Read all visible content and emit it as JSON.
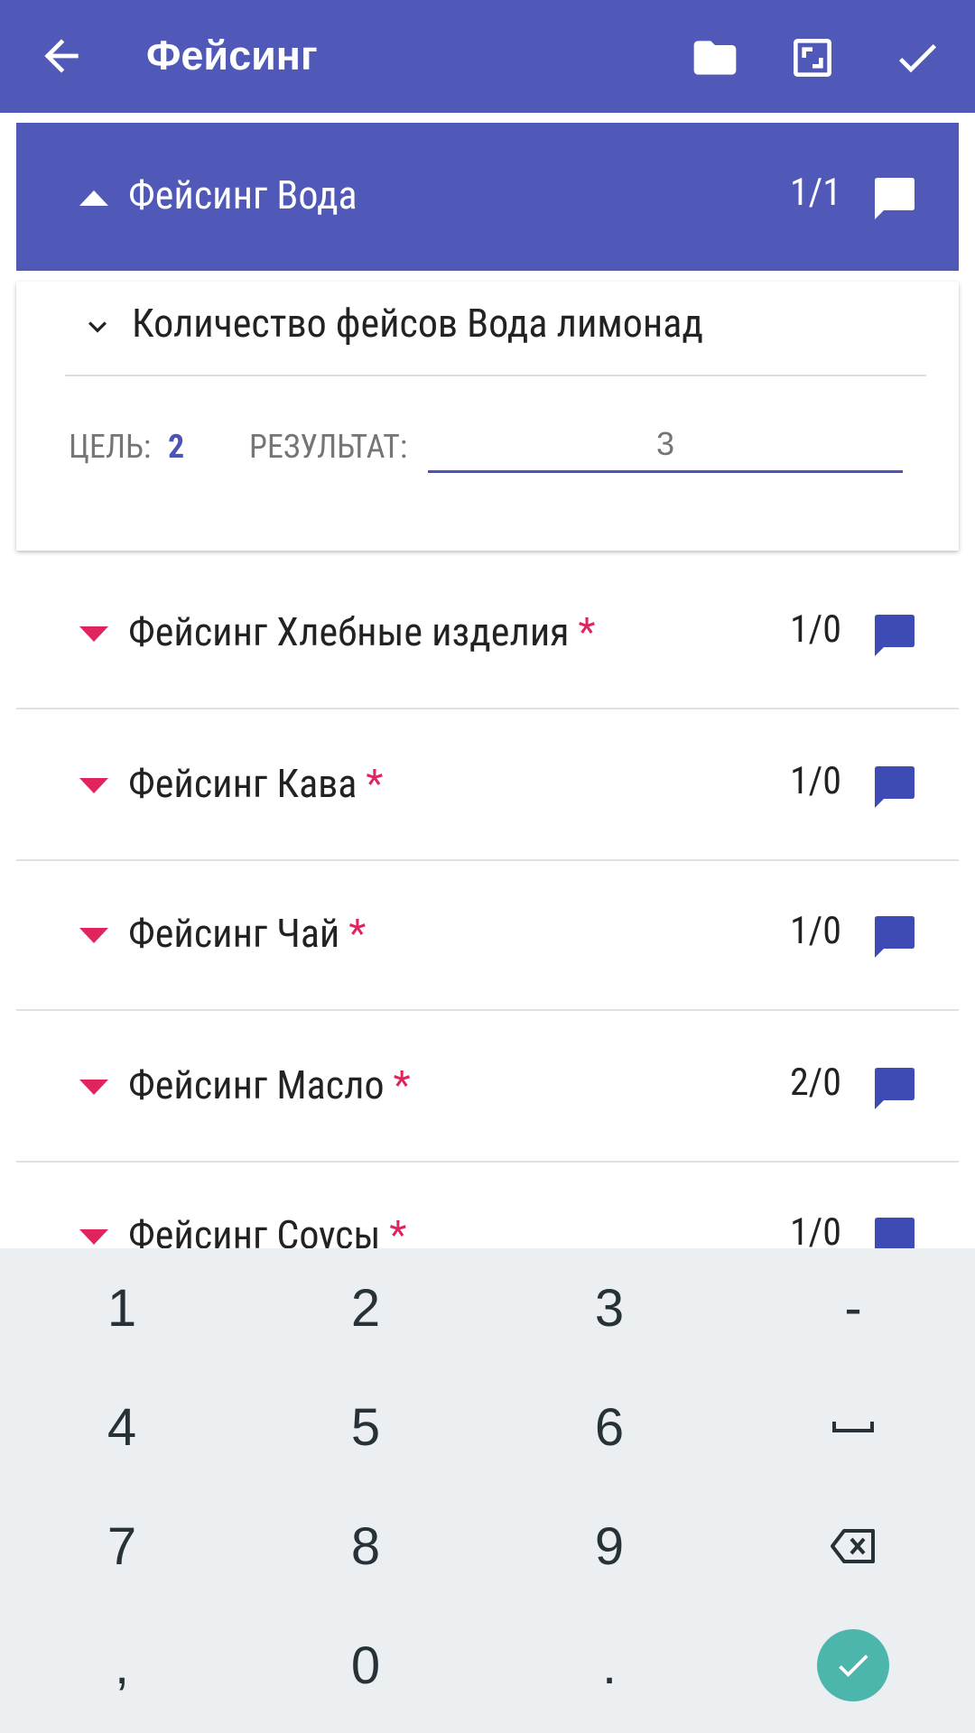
{
  "app_bar": {
    "title": "Фейсинг",
    "icons": [
      "back-arrow-icon",
      "folder-icon",
      "fullscreen-icon",
      "check-icon"
    ]
  },
  "section": {
    "label": "Фейсинг Вода",
    "count": "1/1"
  },
  "question": {
    "label": "Количество фейсов Вода лимонад",
    "goal_label": "ЦЕЛЬ:",
    "goal_value": "2",
    "result_label": "РЕЗУЛЬТАТ:",
    "result_value": "3"
  },
  "rows": [
    {
      "label": "Фейсинг Хлебные изделия",
      "required": "*",
      "count": "1/0"
    },
    {
      "label": "Фейсинг Кава",
      "required": "*",
      "count": "1/0"
    },
    {
      "label": "Фейсинг Чай",
      "required": "*",
      "count": "1/0"
    },
    {
      "label": "Фейсинг Масло",
      "required": "*",
      "count": "2/0"
    },
    {
      "label": "Фейсинг Соусы",
      "required": "*",
      "count": "1/0"
    }
  ],
  "keyboard": {
    "keys": [
      "1",
      "2",
      "3",
      "-",
      "4",
      "5",
      "6",
      "space",
      "7",
      "8",
      "9",
      "backspace",
      ",",
      "0",
      ".",
      "enter"
    ],
    "labels": {
      "k1": "1",
      "k2": "2",
      "k3": "3",
      "kminus": "-",
      "k4": "4",
      "k5": "5",
      "k6": "6",
      "k7": "7",
      "k8": "8",
      "k9": "9",
      "kcomma": ",",
      "k0": "0",
      "kdot": "."
    }
  },
  "colors": {
    "primary": "#5058b8",
    "accent_pink": "#e0245e",
    "comment_blue": "#3f4bb4",
    "enter_teal": "#4db6ac",
    "keyboard_bg": "#eceff1"
  }
}
